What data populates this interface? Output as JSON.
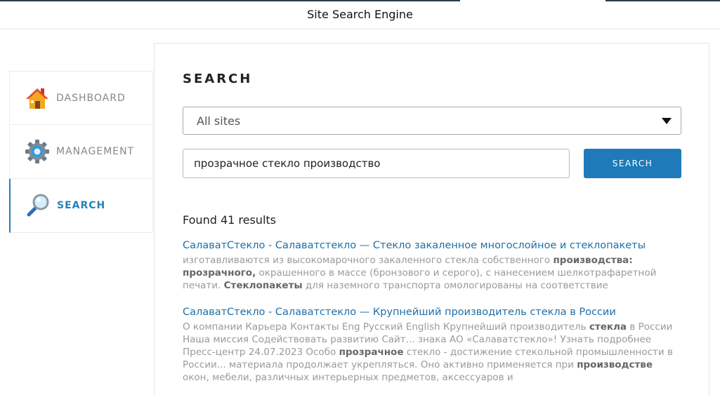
{
  "header": {
    "title": "Site Search Engine"
  },
  "sidebar": {
    "items": [
      {
        "label": "DASHBOARD",
        "icon": "house-icon",
        "active": false
      },
      {
        "label": "MANAGEMENT",
        "icon": "gear-icon",
        "active": false
      },
      {
        "label": "SEARCH",
        "icon": "magnifier-icon",
        "active": true
      }
    ]
  },
  "search": {
    "heading": "SEARCH",
    "site_select": "All sites",
    "query": "прозрачное стекло производство",
    "button_label": "SEARCH",
    "found_text": "Found 41 results"
  },
  "results": [
    {
      "title": "СалаватСтекло - Салаватстекло — Стекло закаленное многослойное и стеклопакеты",
      "snippet": [
        {
          "t": "изготавливаются из высокомарочного закаленного стекла собственного ",
          "b": false
        },
        {
          "t": "производства: прозрачного,",
          "b": true
        },
        {
          "t": " окрашенного в массе (бронзового и серого), с нанесением шелкотрафаретной печати. ",
          "b": false
        },
        {
          "t": "Стеклопакеты",
          "b": true
        },
        {
          "t": " для наземного транспорта омологированы на соответствие",
          "b": false
        }
      ]
    },
    {
      "title": "СалаватСтекло - Салаватстекло — Крупнейший производитель стекла в России",
      "snippet": [
        {
          "t": "О компании Карьера Контакты Eng Русский English Крупнейший производитель ",
          "b": false
        },
        {
          "t": "стекла",
          "b": true
        },
        {
          "t": " в России Наша миссия Содействовать развитию Сайт... знака АО «Салаватстекло»! Узнать подробнее Пресс-центр 24.07.2023 Особо ",
          "b": false
        },
        {
          "t": "прозрачное",
          "b": true
        },
        {
          "t": " стекло - достижение стекольной промышленности в России... материала продолжает укрепляться. Оно активно применяется при ",
          "b": false
        },
        {
          "t": "производстве",
          "b": true
        },
        {
          "t": " окон, мебели, различных интерьерных предметов, аксессуаров и",
          "b": false
        }
      ]
    }
  ],
  "colors": {
    "accent": "#1e7ab8",
    "link": "#1e6fa8",
    "snippet": "#9a9a9a"
  }
}
